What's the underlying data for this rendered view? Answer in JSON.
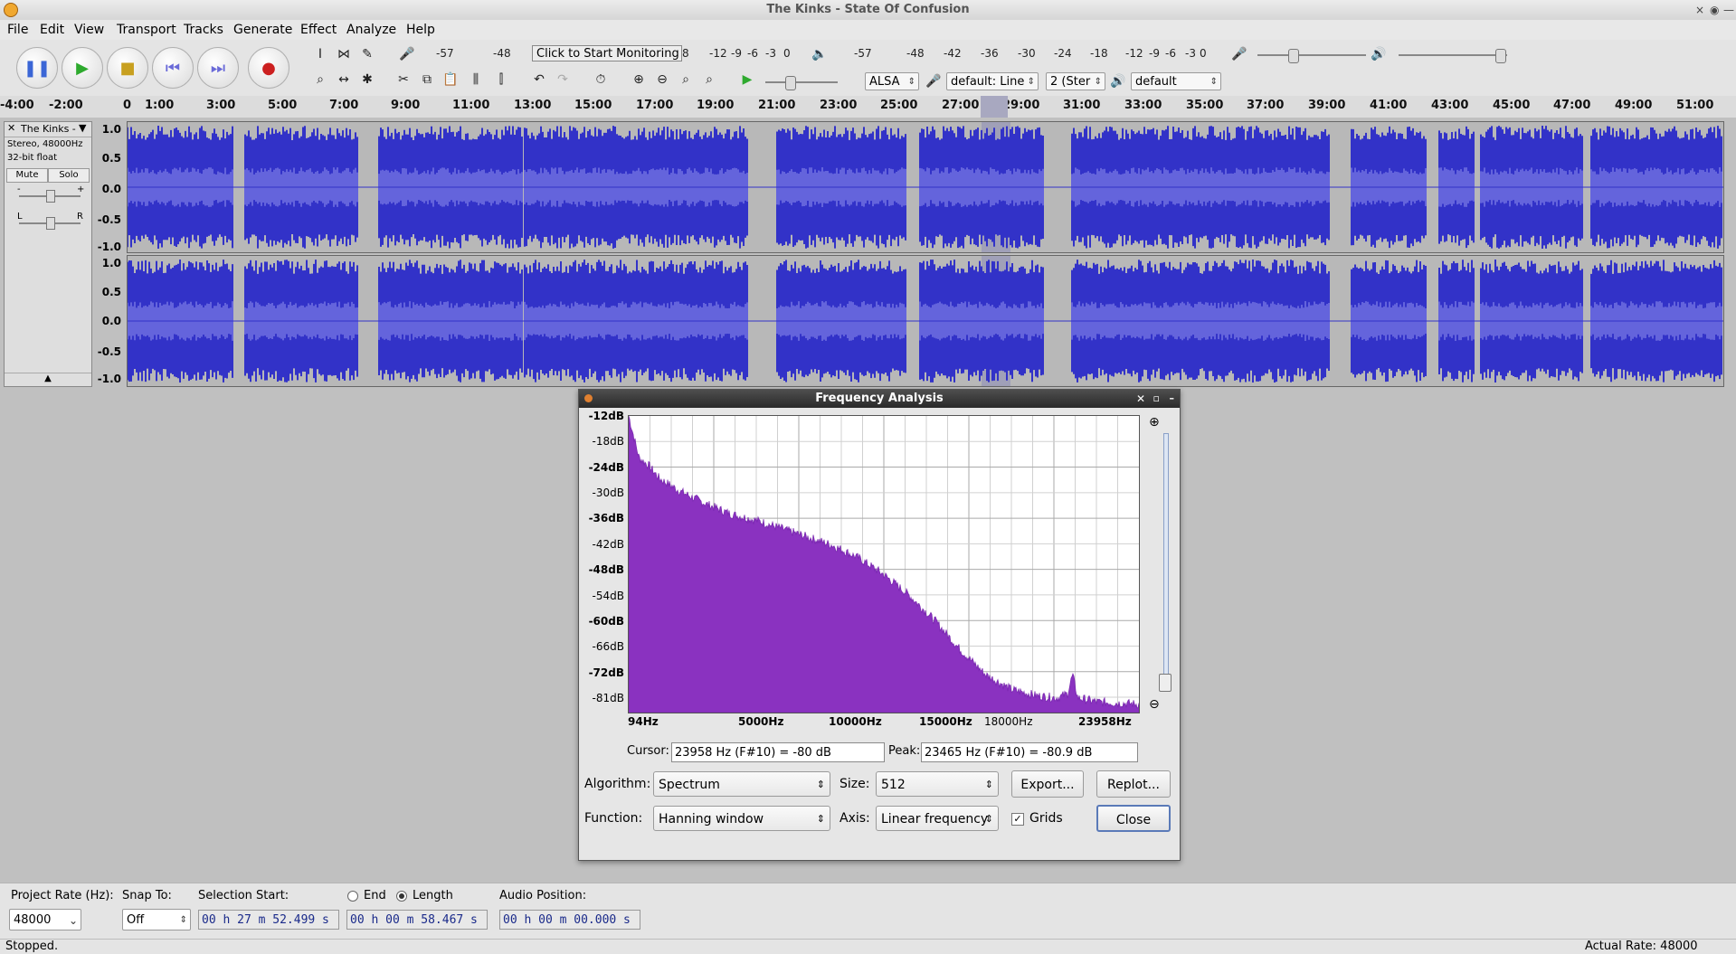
{
  "window": {
    "title": "The Kinks - State Of Confusion",
    "close": "×",
    "restore": "◉",
    "minimize": "—"
  },
  "menu": [
    "File",
    "Edit",
    "View",
    "Transport",
    "Tracks",
    "Generate",
    "Effect",
    "Analyze",
    "Help"
  ],
  "toolbar": {
    "pause": "pause",
    "play": "play",
    "stop": "stop",
    "skip_start": "skip-to-start",
    "skip_end": "skip-to-end",
    "record": "record",
    "rec_meter_ticks": [
      "-57",
      "-48",
      "8",
      "-12",
      "-9",
      "-6",
      "-3",
      "0"
    ],
    "monitor_label": "Click to Start Monitoring",
    "play_meter_ticks": [
      "-57",
      "-48",
      "-42",
      "-36",
      "-30",
      "-24",
      "-18",
      "-12",
      "-9",
      "-6",
      "-3",
      "0"
    ],
    "host": "ALSA",
    "rec_device": "default: Line",
    "channels": "2 (Ster",
    "play_device": "default"
  },
  "ruler": {
    "ticks": [
      "-4:00",
      "-2:00",
      "0",
      "1:00",
      "3:00",
      "5:00",
      "7:00",
      "9:00",
      "11:00",
      "13:00",
      "15:00",
      "17:00",
      "19:00",
      "21:00",
      "23:00",
      "25:00",
      "27:00",
      "29:00",
      "31:00",
      "33:00",
      "35:00",
      "37:00",
      "39:00",
      "41:00",
      "43:00",
      "45:00",
      "47:00",
      "49:00",
      "51:00"
    ]
  },
  "track": {
    "name": "The Kinks -",
    "info1": "Stereo, 48000Hz",
    "info2": "32-bit float",
    "mute": "Mute",
    "solo": "Solo",
    "gain_minus": "-",
    "gain_plus": "+",
    "pan_left": "L",
    "pan_right": "R",
    "scale": [
      "1.0",
      "0.5",
      "0.0",
      "-0.5",
      "-1.0"
    ]
  },
  "dialog": {
    "title": "Frequency Analysis",
    "db_labels": [
      "-12dB",
      "-18dB",
      "-24dB",
      "-30dB",
      "-36dB",
      "-42dB",
      "-48dB",
      "-54dB",
      "-60dB",
      "-66dB",
      "-72dB",
      "-81dB"
    ],
    "freq_labels": [
      "94Hz",
      "5000Hz",
      "10000Hz",
      "15000Hz",
      "18000Hz",
      "23958Hz"
    ],
    "cursor_label": "Cursor:",
    "cursor_value": "23958 Hz (F#10) = -80 dB",
    "peak_label": "Peak:",
    "peak_value": "23465 Hz (F#10) = -80.9 dB",
    "algorithm_label": "Algorithm:",
    "algorithm": "Spectrum",
    "size_label": "Size:",
    "size": "512",
    "export": "Export...",
    "replot": "Replot...",
    "function_label": "Function:",
    "function": "Hanning window",
    "axis_label": "Axis:",
    "axis": "Linear frequency",
    "grids": "Grids",
    "close": "Close"
  },
  "selection": {
    "rate_label": "Project Rate (Hz):",
    "rate": "48000",
    "snap_label": "Snap To:",
    "snap": "Off",
    "start_label": "Selection Start:",
    "start": "00 h 27 m 52.499 s",
    "end_label": "End",
    "length_label": "Length",
    "length": "00 h 00 m 58.467 s",
    "audio_pos_label": "Audio Position:",
    "audio_pos": "00 h 00 m 00.000 s"
  },
  "status": {
    "left": "Stopped.",
    "right": "Actual Rate: 48000"
  }
}
